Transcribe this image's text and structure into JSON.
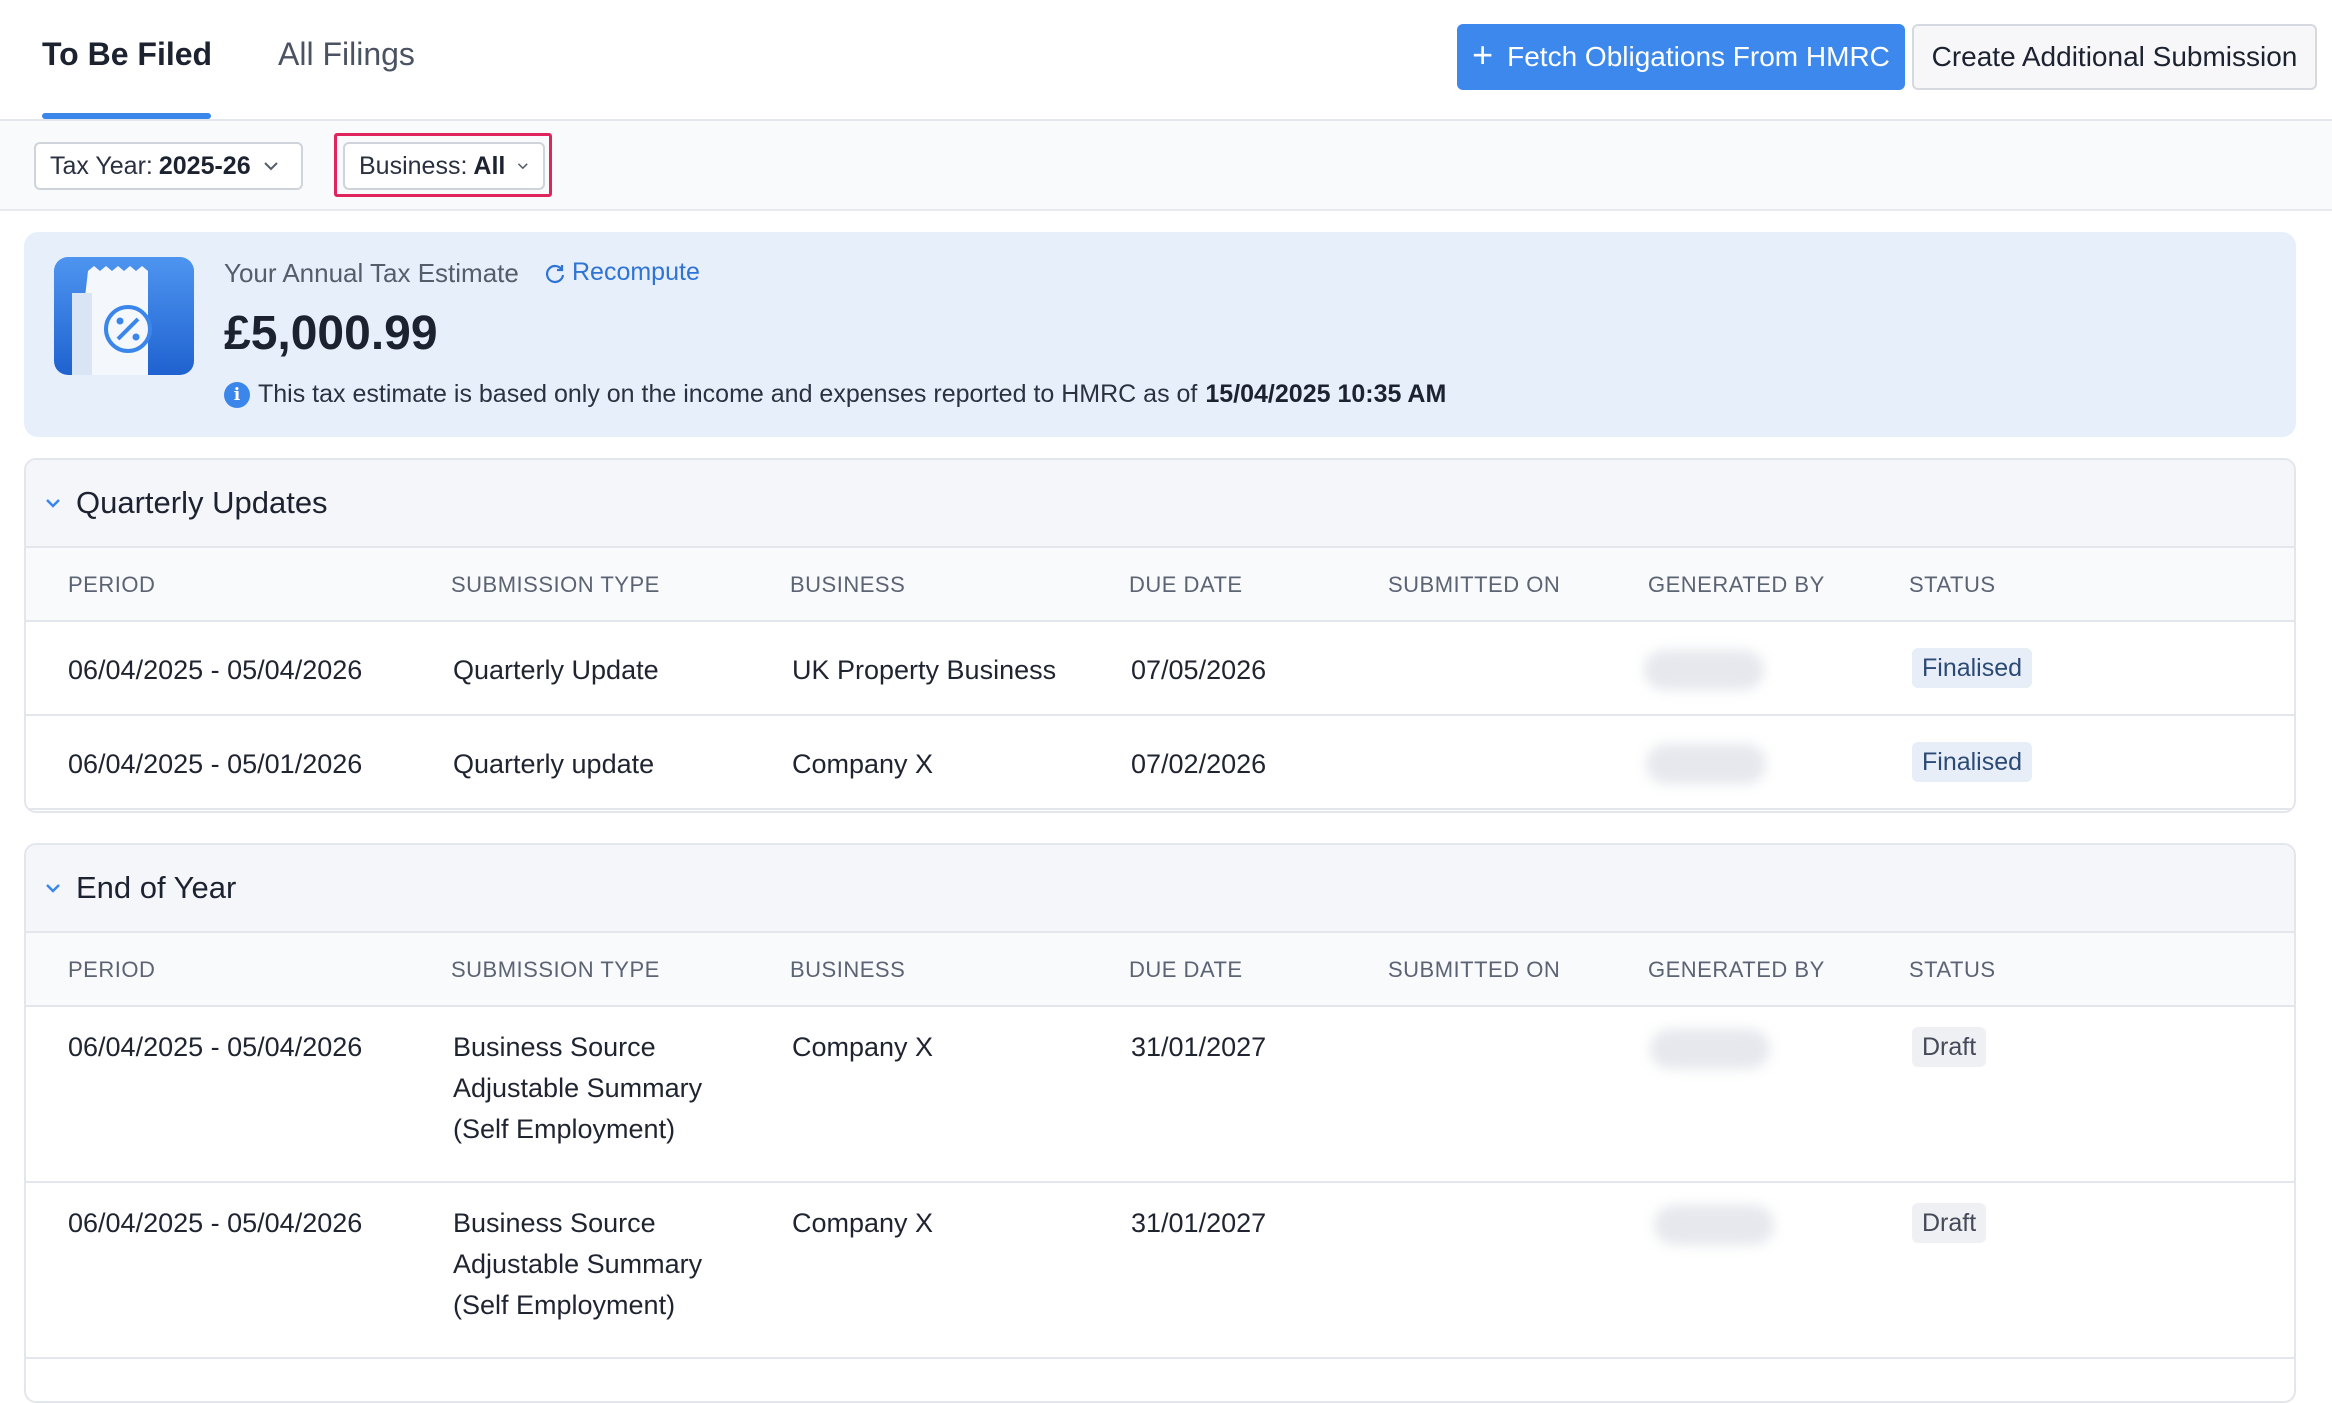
{
  "tabs": {
    "to_be_filed": "To Be Filed",
    "all_filings": "All Filings"
  },
  "actions": {
    "fetch": "Fetch Obligations From HMRC",
    "create": "Create Additional Submission"
  },
  "filters": {
    "tax_year_label": "Tax Year:",
    "tax_year_value": "2025-26",
    "business_label": "Business:",
    "business_value": "All"
  },
  "estimate": {
    "title": "Your Annual Tax Estimate",
    "recompute": "Recompute",
    "amount": "£5,000.99",
    "note": "This tax estimate is based only on the income and expenses reported to HMRC as of",
    "note_date": "15/04/2025 10:35 AM"
  },
  "columns": {
    "period": "PERIOD",
    "type": "SUBMISSION TYPE",
    "business": "BUSINESS",
    "due": "DUE DATE",
    "submitted": "SUBMITTED ON",
    "generated": "GENERATED BY",
    "status": "STATUS"
  },
  "quarterly": {
    "title": "Quarterly Updates",
    "rows": [
      {
        "period": "06/04/2025 - 05/04/2026",
        "type": "Quarterly Update",
        "business": "UK Property Business",
        "due": "07/05/2026",
        "submitted": "",
        "status": "Finalised"
      },
      {
        "period": "06/04/2025 - 05/01/2026",
        "type": "Quarterly update",
        "business": "Company X",
        "due": "07/02/2026",
        "submitted": "",
        "status": "Finalised"
      }
    ]
  },
  "end_of_year": {
    "title": "End of Year",
    "rows": [
      {
        "period": "06/04/2025 - 05/04/2026",
        "type_l1": "Business Source",
        "type_l2": "Adjustable Summary",
        "type_l3": "(Self Employment)",
        "business": "Company X",
        "due": "31/01/2027",
        "submitted": "",
        "status": "Draft"
      },
      {
        "period": "06/04/2025 - 05/04/2026",
        "type_l1": "Business Source",
        "type_l2": "Adjustable Summary",
        "type_l3": "(Self Employment)",
        "business": "Company X",
        "due": "31/01/2027",
        "submitted": "",
        "status": "Draft"
      }
    ]
  },
  "colors": {
    "accent": "#3c88ec",
    "highlight": "#e0245e",
    "estimate_bg": "#e7effb"
  },
  "icons": [
    "plus-icon",
    "chevron-down-icon",
    "refresh-icon",
    "info-icon",
    "receipt-percent-icon"
  ]
}
